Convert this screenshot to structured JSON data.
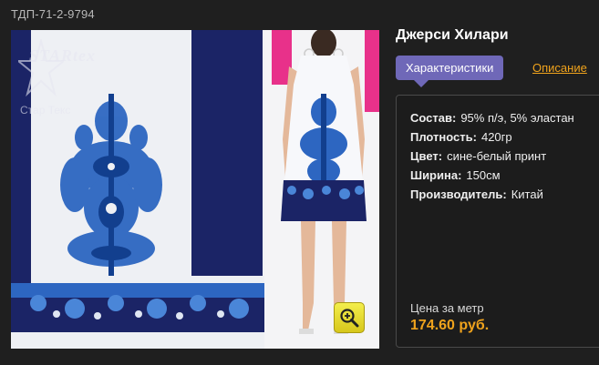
{
  "product": {
    "sku": "ТДП-71-2-9794",
    "title": "Джерси Хилари"
  },
  "photo": {
    "logo_title": "STARtex",
    "logo_subtitle": "Стар Текс",
    "zoom_icon": "zoom-in-icon"
  },
  "tabs": [
    {
      "label": "Характеристики",
      "active": true
    },
    {
      "label": "Описание",
      "active": false
    }
  ],
  "specs": [
    {
      "key": "Состав:",
      "value": "95% п/э, 5% эластан"
    },
    {
      "key": "Плотность:",
      "value": "420гр"
    },
    {
      "key": "Цвет:",
      "value": "сине-белый принт"
    },
    {
      "key": "Ширина:",
      "value": "150см"
    },
    {
      "key": "Производитель:",
      "value": "Китай"
    }
  ],
  "price": {
    "label": "Цена за метр",
    "value": "174.60 руб."
  },
  "colors": {
    "background": "#1f1f1f",
    "accent_tab": "#6f68b8",
    "accent_price": "#f0a31c",
    "fabric_navy": "#1b2466",
    "fabric_blue": "#2f6fc4"
  }
}
